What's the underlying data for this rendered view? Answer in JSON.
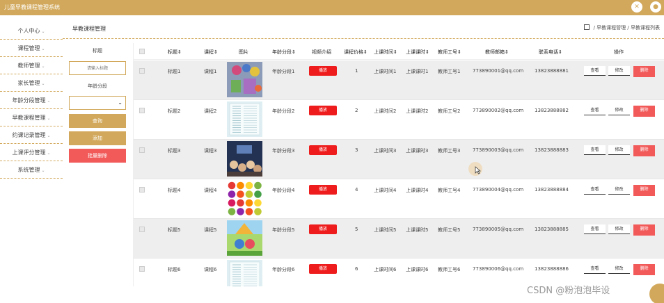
{
  "app": {
    "title": "儿童早教课程管理系统"
  },
  "sidebar": {
    "items": [
      {
        "label": "个人中心"
      },
      {
        "label": "课程管理"
      },
      {
        "label": "教师管理"
      },
      {
        "label": "家长管理"
      },
      {
        "label": "年龄分段管理"
      },
      {
        "label": "早教课程管理"
      },
      {
        "label": "约课记录管理"
      },
      {
        "label": "上课评分管理"
      },
      {
        "label": "系统管理"
      }
    ]
  },
  "header": {
    "page_title": "早教课程管理",
    "breadcrumb": [
      "早教课程管理",
      "早教课程列表"
    ],
    "separator": "/"
  },
  "filter": {
    "title_label": "标题",
    "title_placeholder": "请输入标题",
    "age_label": "年龄分段",
    "query_button": "查询",
    "add_button": "添加",
    "batch_delete_button": "批量删除"
  },
  "table": {
    "columns": [
      "标题",
      "课程",
      "图片",
      "年龄分段",
      "视频介绍",
      "课程价格",
      "上课时间",
      "上课课时",
      "教师工号",
      "教师邮箱",
      "联系电话",
      "操作"
    ],
    "sort_mark": "⇕",
    "rows": [
      {
        "title": "标题1",
        "course": "课程1",
        "age": "年龄分段1",
        "video": "播放",
        "price": "1",
        "time": "上课时间1",
        "hours": "上课课时1",
        "teacher_id": "教师工号1",
        "email": "773890001@qq.com",
        "phone": "13823888881",
        "img": "toys"
      },
      {
        "title": "标题2",
        "course": "课程2",
        "age": "年龄分段2",
        "video": "播放",
        "price": "2",
        "time": "上课时间2",
        "hours": "上课课时2",
        "teacher_id": "教师工号2",
        "email": "773890002@qq.com",
        "phone": "13823888882",
        "img": "doc"
      },
      {
        "title": "标题3",
        "course": "课程3",
        "age": "年龄分段3",
        "video": "播放",
        "price": "3",
        "time": "上课时间3",
        "hours": "上课课时3",
        "teacher_id": "教师工号3",
        "email": "773890003@qq.com",
        "phone": "13823888883",
        "img": "class"
      },
      {
        "title": "标题4",
        "course": "课程4",
        "age": "年龄分段4",
        "video": "播放",
        "price": "4",
        "time": "上课时间4",
        "hours": "上课课时4",
        "teacher_id": "教师工号4",
        "email": "773890004@qq.com",
        "phone": "13823888884",
        "img": "fruit"
      },
      {
        "title": "标题5",
        "course": "课程5",
        "age": "年龄分段5",
        "video": "播放",
        "price": "5",
        "time": "上课时间5",
        "hours": "上课课时5",
        "teacher_id": "教师工号5",
        "email": "773890005@qq.com",
        "phone": "13823888885",
        "img": "cartoon"
      },
      {
        "title": "标题6",
        "course": "课程6",
        "age": "年龄分段6",
        "video": "播放",
        "price": "6",
        "time": "上课时间6",
        "hours": "上课课时6",
        "teacher_id": "教师工号6",
        "email": "773890006@qq.com",
        "phone": "13823888886",
        "img": "doc"
      }
    ],
    "actions": {
      "view": "查看",
      "edit": "修改",
      "delete": "删除"
    }
  },
  "watermark": "CSDN @粉泡泡毕设",
  "colors": {
    "brand": "#d2a95c",
    "danger": "#f25a5a",
    "play": "#ee1c1c",
    "row_shade": "#eeeeee"
  }
}
